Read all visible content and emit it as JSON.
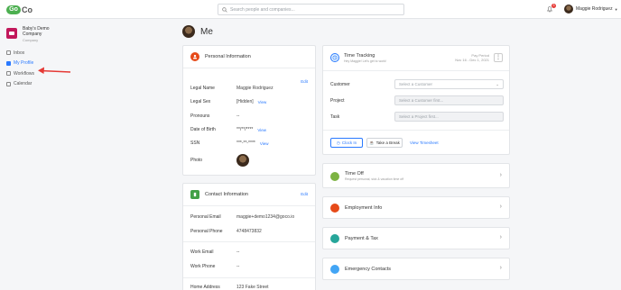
{
  "header": {
    "logo_mark": "Go",
    "logo_text": "Co",
    "search_placeholder": "Search people and companies...",
    "notification_count": "3",
    "user_name": "Maggie Rodriguez"
  },
  "sidebar": {
    "company_name": "Baby's Demo Company",
    "company_sub": "Company",
    "items": [
      {
        "label": "Inbox",
        "icon": "inbox-icon"
      },
      {
        "label": "My Profile",
        "icon": "profile-icon",
        "active": true
      },
      {
        "label": "Workflows",
        "icon": "workflows-icon"
      },
      {
        "label": "Calendar",
        "icon": "calendar-icon"
      }
    ],
    "arrow_color": "#e53935"
  },
  "page": {
    "title": "Me"
  },
  "personal": {
    "title": "Personal Information",
    "edit": "Edit",
    "view": "View",
    "fields": [
      {
        "label": "Legal Name",
        "value": "Maggie Rodriguez"
      },
      {
        "label": "Legal Sex",
        "value": "[Hidden]"
      },
      {
        "label": "Pronouns",
        "value": "--"
      },
      {
        "label": "Date of Birth",
        "value": "**/**/****"
      },
      {
        "label": "SSN",
        "value": "***-**-****"
      },
      {
        "label": "Photo",
        "value": ""
      }
    ]
  },
  "contact": {
    "title": "Contact Information",
    "edit": "Edit",
    "fields": [
      {
        "label": "Personal Email",
        "value": "maggie+demo1234@goco.io"
      },
      {
        "label": "Personal Phone",
        "value": "4748473832"
      },
      {
        "label": "Work Email",
        "value": "--"
      },
      {
        "label": "Work Phone",
        "value": "--"
      },
      {
        "label": "Home Address",
        "value": "123 Fake Street"
      }
    ]
  },
  "time_tracking": {
    "title": "Time Tracking",
    "subtitle": "Hey Maggie! Let's get to work!",
    "pay_period_label": "Pay Period",
    "pay_period_value": "Nov 16 - Dec 1, 2021",
    "customer_label": "Customer",
    "customer_placeholder": "Select a Customer",
    "project_label": "Project",
    "project_placeholder": "Select a Customer first...",
    "task_label": "Task",
    "task_placeholder": "Select a Project first...",
    "clock_in": "Clock In",
    "take_break": "Take a Break",
    "view_timesheet": "View Timesheet"
  },
  "sections": [
    {
      "title": "Time Off",
      "subtitle": "Request personal, sick & vacation time off",
      "icon": "time-off-icon",
      "color": "#7cb342"
    },
    {
      "title": "Employment Info",
      "subtitle": "",
      "icon": "employment-icon",
      "color": "#e64a19"
    },
    {
      "title": "Payment & Tax",
      "subtitle": "",
      "icon": "payment-icon",
      "color": "#26a69a"
    },
    {
      "title": "Emergency Contacts",
      "subtitle": "",
      "icon": "emergency-icon",
      "color": "#42a5f5"
    }
  ]
}
